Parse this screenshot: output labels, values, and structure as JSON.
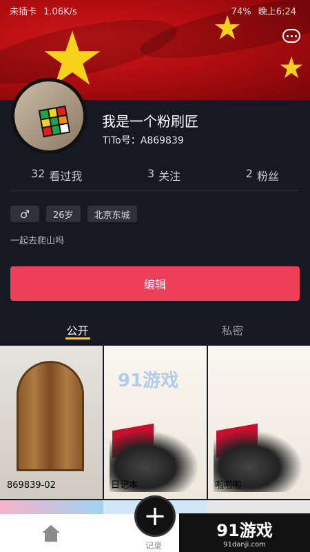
{
  "statusbar": {
    "left_text": "未插卡",
    "speed": "1.06K/s",
    "battery": "74%",
    "time_label": "晚上6:24"
  },
  "profile": {
    "nickname": "我是一个粉刷匠",
    "tito_id": "TiTo号：A869839",
    "stats": [
      {
        "count": "32",
        "label": "看过我"
      },
      {
        "count": "3",
        "label": "关注"
      },
      {
        "count": "2",
        "label": "粉丝"
      }
    ],
    "gender_symbol": "♂",
    "age": "26岁",
    "location": "北京东城",
    "bio": "一起去爬山吗"
  },
  "actions": {
    "edit_label": "编辑"
  },
  "tabs": [
    {
      "label": "公开",
      "active": true
    },
    {
      "label": "私密",
      "active": false
    }
  ],
  "grid": {
    "items": [
      {
        "label": "869839-02"
      },
      {
        "label": "日记本"
      },
      {
        "label": "啦啦啦"
      }
    ]
  },
  "bottom": {
    "record_label": "记录",
    "add_symbol": "+",
    "watermark_big": "91游戏",
    "watermark_small": "91danji.com",
    "watermark_mid": "91游戏"
  },
  "colors": {
    "accent": "#ee3f5a",
    "tab_indicator": "#facd1a",
    "background": "#161823"
  },
  "icons": [
    "more-icon",
    "gender-male-icon",
    "home-icon",
    "add-icon"
  ]
}
